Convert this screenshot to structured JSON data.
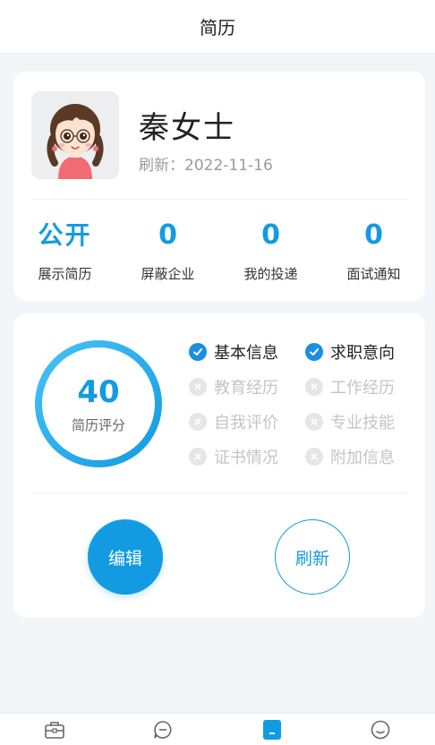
{
  "header": {
    "title": "简历"
  },
  "profile": {
    "name": "秦女士",
    "refresh_label": "刷新：",
    "refresh_date": "2022-11-16",
    "avatar_icon": "girl-avatar"
  },
  "stats": [
    {
      "value": "公开",
      "label": "展示简历"
    },
    {
      "value": "0",
      "label": "屏蔽企业"
    },
    {
      "value": "0",
      "label": "我的投递"
    },
    {
      "value": "0",
      "label": "面试通知"
    }
  ],
  "score": {
    "value": "40",
    "label": "简历评分",
    "progress_percent": 40
  },
  "checklist": [
    {
      "label": "基本信息",
      "status": "done"
    },
    {
      "label": "求职意向",
      "status": "done"
    },
    {
      "label": "教育经历",
      "status": "todo"
    },
    {
      "label": "工作经历",
      "status": "todo"
    },
    {
      "label": "自我评价",
      "status": "todo"
    },
    {
      "label": "专业技能",
      "status": "todo"
    },
    {
      "label": "证书情况",
      "status": "todo"
    },
    {
      "label": "附加信息",
      "status": "todo"
    }
  ],
  "actions": {
    "edit_label": "编辑",
    "refresh_label": "刷新"
  },
  "tabbar": [
    {
      "icon": "briefcase-icon",
      "active": false
    },
    {
      "icon": "chat-icon",
      "active": false
    },
    {
      "icon": "resume-icon",
      "active": true
    },
    {
      "icon": "smile-icon",
      "active": false
    }
  ],
  "colors": {
    "accent": "#139be2",
    "check_done": "#1a8fe3",
    "check_todo": "#e6e6e6",
    "background": "#f3f5f9"
  }
}
